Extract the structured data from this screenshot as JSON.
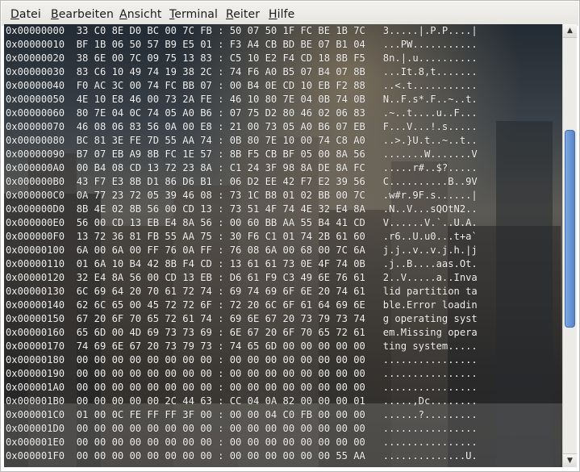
{
  "menu": {
    "items": [
      {
        "pre": "",
        "acc": "D",
        "post": "atei"
      },
      {
        "pre": "",
        "acc": "B",
        "post": "earbeiten"
      },
      {
        "pre": "",
        "acc": "A",
        "post": "nsicht"
      },
      {
        "pre": "",
        "acc": "T",
        "post": "erminal"
      },
      {
        "pre": "",
        "acc": "R",
        "post": "eiter"
      },
      {
        "pre": "",
        "acc": "H",
        "post": "ilfe"
      }
    ]
  },
  "terminal": {
    "lines": [
      "0x00000000  33 C0 8E D0 BC 00 7C FB : 50 07 50 1F FC BE 1B 7C   3.....|.P.P....|",
      "0x00000010  BF 1B 06 50 57 B9 E5 01 : F3 A4 CB BD BE 07 B1 04   ...PW...........",
      "0x00000020  38 6E 00 7C 09 75 13 83 : C5 10 E2 F4 CD 18 8B F5   8n.|.u..........",
      "0x00000030  83 C6 10 49 74 19 38 2C : 74 F6 A0 B5 07 B4 07 8B   ...It.8,t.......",
      "0x00000040  F0 AC 3C 00 74 FC BB 07 : 00 B4 0E CD 10 EB F2 88   ..<.t...........",
      "0x00000050  4E 10 E8 46 00 73 2A FE : 46 10 80 7E 04 0B 74 0B   N..F.s*.F..~..t.",
      "0x00000060  80 7E 04 0C 74 05 A0 B6 : 07 75 D2 80 46 02 06 83   .~..t....u..F...",
      "0x00000070  46 08 06 83 56 0A 00 E8 : 21 00 73 05 A0 B6 07 EB   F...V...!.s.....",
      "0x00000080  BC 81 3E FE 7D 55 AA 74 : 0B 80 7E 10 00 74 C8 A0   ..>.}U.t..~..t..",
      "0x00000090  B7 07 EB A9 8B FC 1E 57 : 8B F5 CB BF 05 00 8A 56   .......W.......V",
      "0x000000A0  00 B4 08 CD 13 72 23 8A : C1 24 3F 98 8A DE 8A FC   .....r#..$?.....",
      "0x000000B0  43 F7 E3 8B D1 86 D6 B1 : 06 D2 EE 42 F7 E2 39 56   C..........B..9V",
      "0x000000C0  0A 77 23 72 05 39 46 08 : 73 1C B8 01 02 BB 00 7C   .w#r.9F.s......|",
      "0x000000D0  8B 4E 02 8B 56 00 CD 13 : 73 51 4F 74 4E 32 E4 8A   .N..V...sQOtN2..",
      "0x000000E0  56 00 CD 13 EB E4 8A 56 : 00 60 BB AA 55 B4 41 CD   V......V.`..U.A.",
      "0x000000F0  13 72 36 81 FB 55 AA 75 : 30 F6 C1 01 74 2B 61 60   .r6..U.u0...t+a`",
      "0x00000100  6A 00 6A 00 FF 76 0A FF : 76 08 6A 00 68 00 7C 6A   j.j..v..v.j.h.|j",
      "0x00000110  01 6A 10 B4 42 8B F4 CD : 13 61 61 73 0E 4F 74 0B   .j..B....aas.Ot.",
      "0x00000120  32 E4 8A 56 00 CD 13 EB : D6 61 F9 C3 49 6E 76 61   2..V.....a..Inva",
      "0x00000130  6C 69 64 20 70 61 72 74 : 69 74 69 6F 6E 20 74 61   lid partition ta",
      "0x00000140  62 6C 65 00 45 72 72 6F : 72 20 6C 6F 61 64 69 6E   ble.Error loadin",
      "0x00000150  67 20 6F 70 65 72 61 74 : 69 6E 67 20 73 79 73 74   g operating syst",
      "0x00000160  65 6D 00 4D 69 73 73 69 : 6E 67 20 6F 70 65 72 61   em.Missing opera",
      "0x00000170  74 69 6E 67 20 73 79 73 : 74 65 6D 00 00 00 00 00   ting system.....",
      "0x00000180  00 00 00 00 00 00 00 00 : 00 00 00 00 00 00 00 00   ................",
      "0x00000190  00 00 00 00 00 00 00 00 : 00 00 00 00 00 00 00 00   ................",
      "0x000001A0  00 00 00 00 00 00 00 00 : 00 00 00 00 00 00 00 00   ................",
      "0x000001B0  00 00 00 00 00 2C 44 63 : CC 04 0A 82 00 00 00 01   .....,Dc........",
      "0x000001C0  01 00 0C FE FF FF 3F 00 : 00 00 04 C0 FB 00 00 00   ......?.........",
      "0x000001D0  00 00 00 00 00 00 00 00 : 00 00 00 00 00 00 00 00   ................",
      "0x000001E0  00 00 00 00 00 00 00 00 : 00 00 00 00 00 00 00 00   ................",
      "0x000001F0  00 00 00 00 00 00 00 00 : 00 00 00 00 00 00 55 AA   ..............U."
    ]
  },
  "scrollbar": {
    "up_icon": "arrow-up-icon",
    "down_icon": "arrow-down-icon",
    "position_fraction": 0.42
  }
}
